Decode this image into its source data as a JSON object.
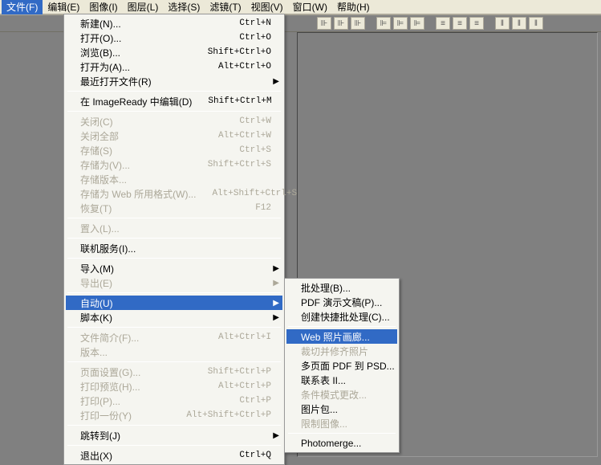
{
  "menubar": [
    {
      "label": "文件(F)",
      "active": true
    },
    {
      "label": "编辑(E)"
    },
    {
      "label": "图像(I)"
    },
    {
      "label": "图层(L)"
    },
    {
      "label": "选择(S)"
    },
    {
      "label": "滤镜(T)"
    },
    {
      "label": "视图(V)"
    },
    {
      "label": "窗口(W)"
    },
    {
      "label": "帮助(H)"
    }
  ],
  "file_menu": [
    {
      "label": "新建(N)...",
      "shortcut": "Ctrl+N"
    },
    {
      "label": "打开(O)...",
      "shortcut": "Ctrl+O"
    },
    {
      "label": "浏览(B)...",
      "shortcut": "Shift+Ctrl+O"
    },
    {
      "label": "打开为(A)...",
      "shortcut": "Alt+Ctrl+O"
    },
    {
      "label": "最近打开文件(R)",
      "arrow": true
    },
    {
      "sep": true
    },
    {
      "label": "在 ImageReady 中编辑(D)",
      "shortcut": "Shift+Ctrl+M"
    },
    {
      "sep": true
    },
    {
      "label": "关闭(C)",
      "shortcut": "Ctrl+W",
      "disabled": true
    },
    {
      "label": "关闭全部",
      "shortcut": "Alt+Ctrl+W",
      "disabled": true
    },
    {
      "label": "存储(S)",
      "shortcut": "Ctrl+S",
      "disabled": true
    },
    {
      "label": "存储为(V)...",
      "shortcut": "Shift+Ctrl+S",
      "disabled": true
    },
    {
      "label": "存储版本...",
      "disabled": true
    },
    {
      "label": "存储为 Web 所用格式(W)...",
      "shortcut": "Alt+Shift+Ctrl+S",
      "disabled": true
    },
    {
      "label": "恢复(T)",
      "shortcut": "F12",
      "disabled": true
    },
    {
      "sep": true
    },
    {
      "label": "置入(L)...",
      "disabled": true
    },
    {
      "sep": true
    },
    {
      "label": "联机服务(I)..."
    },
    {
      "sep": true
    },
    {
      "label": "导入(M)",
      "arrow": true
    },
    {
      "label": "导出(E)",
      "arrow": true,
      "disabled": true
    },
    {
      "sep": true
    },
    {
      "label": "自动(U)",
      "arrow": true,
      "highlighted": true
    },
    {
      "label": "脚本(K)",
      "arrow": true
    },
    {
      "sep": true
    },
    {
      "label": "文件简介(F)...",
      "shortcut": "Alt+Ctrl+I",
      "disabled": true
    },
    {
      "label": "版本...",
      "disabled": true
    },
    {
      "sep": true
    },
    {
      "label": "页面设置(G)...",
      "shortcut": "Shift+Ctrl+P",
      "disabled": true
    },
    {
      "label": "打印预览(H)...",
      "shortcut": "Alt+Ctrl+P",
      "disabled": true
    },
    {
      "label": "打印(P)...",
      "shortcut": "Ctrl+P",
      "disabled": true
    },
    {
      "label": "打印一份(Y)",
      "shortcut": "Alt+Shift+Ctrl+P",
      "disabled": true
    },
    {
      "sep": true
    },
    {
      "label": "跳转到(J)",
      "arrow": true
    },
    {
      "sep": true
    },
    {
      "label": "退出(X)",
      "shortcut": "Ctrl+Q"
    }
  ],
  "sub_menu": [
    {
      "label": "批处理(B)..."
    },
    {
      "label": "PDF 演示文稿(P)..."
    },
    {
      "label": "创建快捷批处理(C)..."
    },
    {
      "sep": true
    },
    {
      "label": "Web 照片画廊...",
      "highlighted": true
    },
    {
      "label": "裁切并修齐照片",
      "disabled": true
    },
    {
      "label": "多页面 PDF 到 PSD..."
    },
    {
      "label": "联系表 II..."
    },
    {
      "label": "条件模式更改...",
      "disabled": true
    },
    {
      "label": "图片包..."
    },
    {
      "label": "限制图像...",
      "disabled": true
    },
    {
      "sep": true
    },
    {
      "label": "Photomerge..."
    }
  ]
}
